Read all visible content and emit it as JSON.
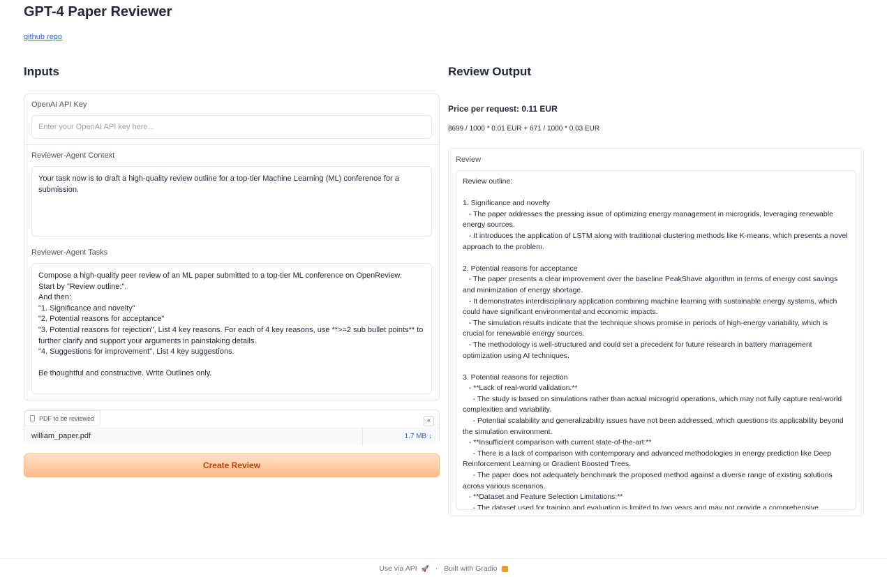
{
  "header": {
    "title": "GPT-4 Paper Reviewer",
    "repo_link": "github repo"
  },
  "inputs": {
    "heading": "Inputs",
    "api_key": {
      "label": "OpenAI API Key",
      "placeholder": "Enter your OpenAI API key here..."
    },
    "context": {
      "label": "Reviewer-Agent Context",
      "value": "Your task now is to draft a high-quality review outline for a top-tier Machine Learning (ML) conference for a submission."
    },
    "tasks": {
      "label": "Reviewer-Agent Tasks",
      "value": "Compose a high-quality peer review of an ML paper submitted to a top-tier ML conference on OpenReview.\nStart by \"Review outline:\".\nAnd then:\n\"1. Significance and novelty\"\n\"2. Potential reasons for acceptance\"\n\"3. Potential reasons for rejection\", List 4 key reasons. For each of 4 key reasons, use **>=2 sub bullet points** to further clarify and support your arguments in painstaking details.\n\"4. Suggestions for improvement\", List 4 key suggestions.\n\nBe thoughtful and constructive. Write Outlines only."
    },
    "file": {
      "label": "PDF to be reviewed",
      "name": "william_paper.pdf",
      "size": "1.7 MB ↓",
      "clear": "×"
    },
    "submit_label": "Create Review"
  },
  "output": {
    "heading": "Review Output",
    "price_title": "Price per request: 0.11 EUR",
    "price_calc": "8699 / 1000 * 0.01 EUR + 671 / 1000 * 0.03 EUR",
    "review_label": "Review",
    "review_text": "Review outline:\n\n1. Significance and novelty\n   - The paper addresses the pressing issue of optimizing energy management in microgrids, leveraging renewable energy sources.\n   - It introduces the application of LSTM along with traditional clustering methods like K-means, which presents a novel approach to the problem.\n\n2. Potential reasons for acceptance\n   - The paper presents a clear improvement over the baseline PeakShave algorithm in terms of energy cost savings and minimization of energy shortage.\n   - It demonstrates interdisciplinary application combining machine learning with sustainable energy systems, which could have significant environmental and economic impacts.\n   - The simulation results indicate that the technique shows promise in periods of high-energy variability, which is crucial for renewable energy sources.\n   - The methodology is well-structured and could set a precedent for future research in battery management optimization using AI techniques.\n\n3. Potential reasons for rejection\n   - **Lack of real-world validation:**\n     - The study is based on simulations rather than actual microgrid operations, which may not fully capture real-world complexities and variability.\n     - Potential scalability and generalizability issues have not been addressed, which questions its applicability beyond the simulation environment.\n   - **Insufficient comparison with current state-of-the-art:**\n     - There is a lack of comparison with contemporary and advanced methodologies in energy prediction like Deep Reinforcement Learning or Gradient Boosted Trees.\n     - The paper does not adequately benchmark the proposed method against a diverse range of existing solutions across various scenarios.\n   - **Dataset and Feature Selection Limitations:**\n     - The dataset used for training and evaluation is limited to two years and may not provide a comprehensive"
  },
  "footer": {
    "api": "Use via API",
    "separator": "·",
    "built": "Built with Gradio"
  },
  "colors": {
    "accent": "#f97316",
    "link": "#2563eb",
    "border": "#e5e7eb"
  }
}
